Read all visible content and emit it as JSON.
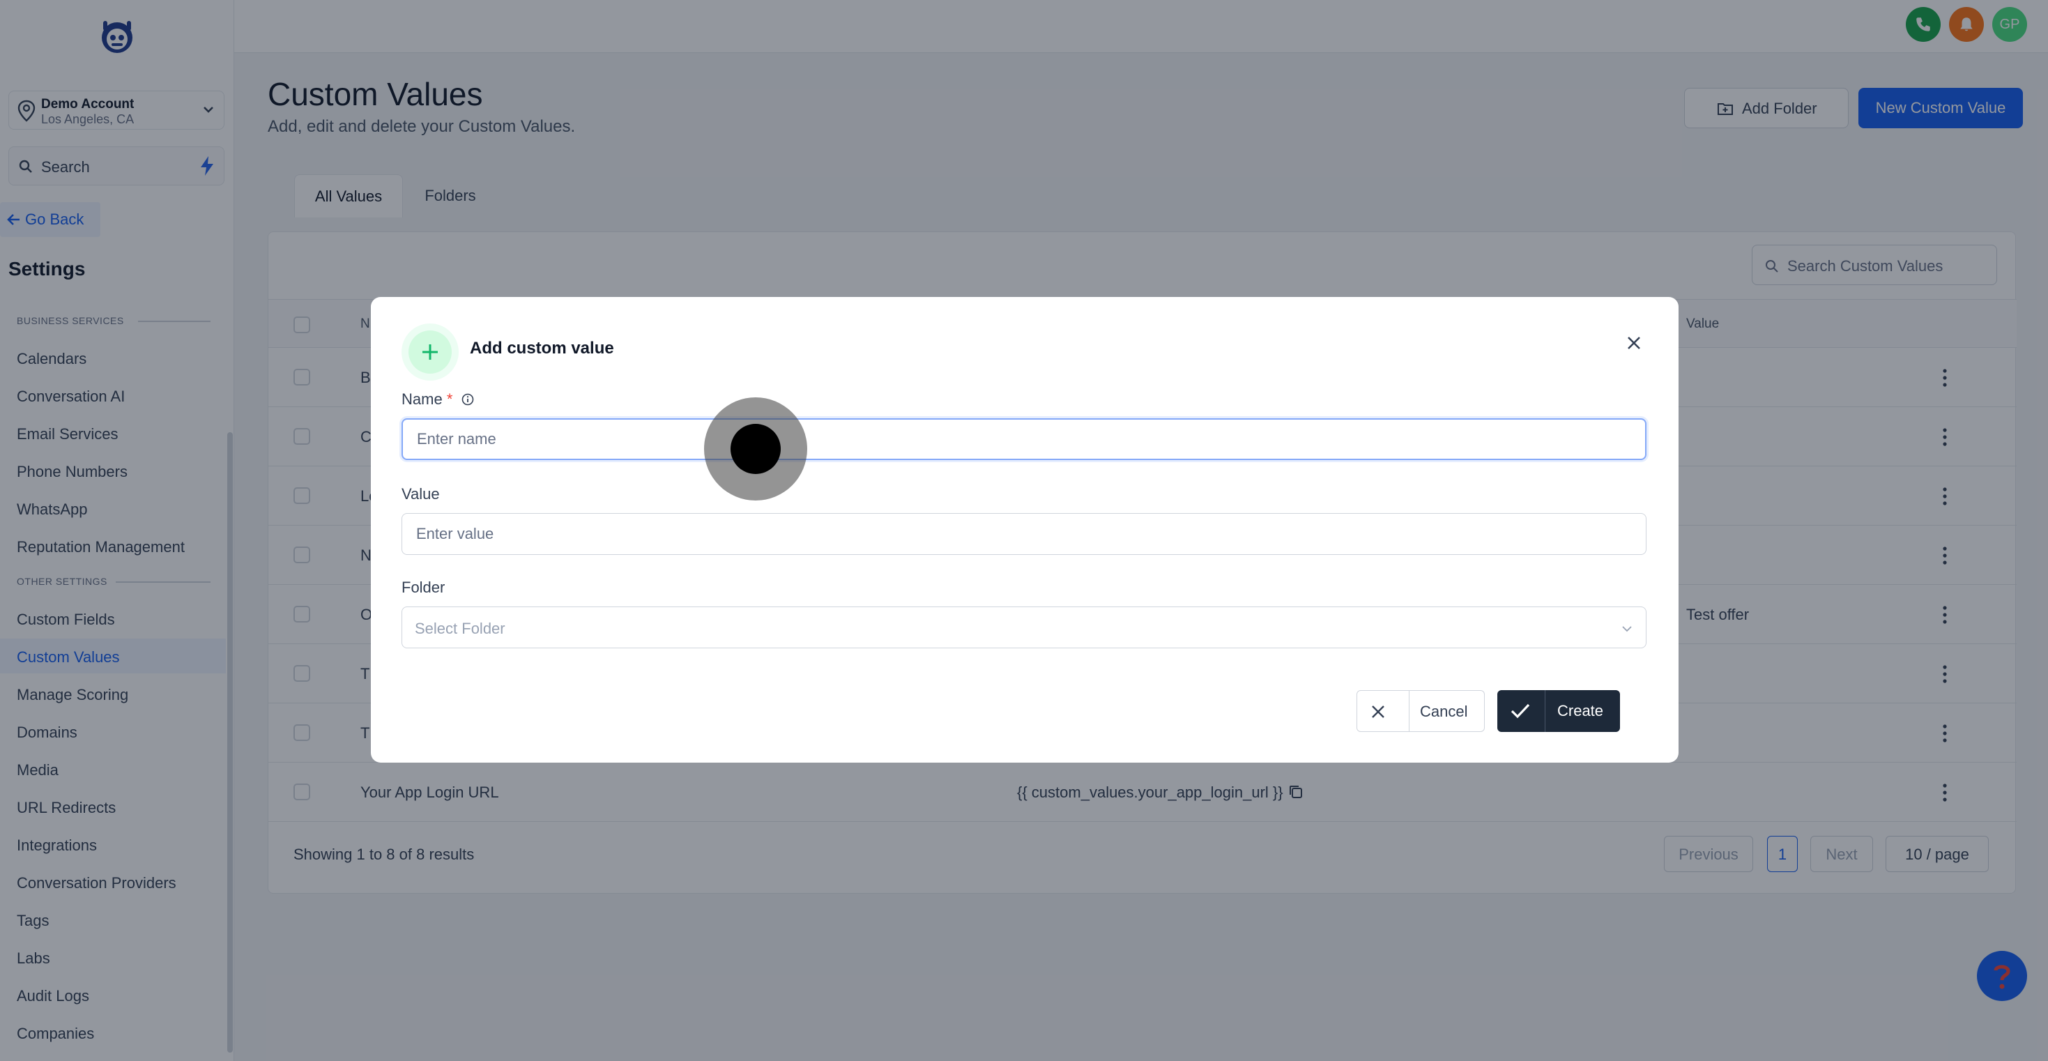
{
  "sidebar": {
    "account": {
      "name": "Demo Account",
      "location": "Los Angeles, CA"
    },
    "search_label": "Search",
    "go_back": "Go Back",
    "title": "Settings",
    "sections": [
      {
        "heading": "BUSINESS SERVICES",
        "items": [
          "Calendars",
          "Conversation AI",
          "Email Services",
          "Phone Numbers",
          "WhatsApp",
          "Reputation Management"
        ]
      },
      {
        "heading": "OTHER SETTINGS",
        "items": [
          "Custom Fields",
          "Custom Values",
          "Manage Scoring",
          "Domains",
          "Media",
          "URL Redirects",
          "Integrations",
          "Conversation Providers",
          "Tags",
          "Labs",
          "Audit Logs",
          "Companies"
        ]
      }
    ],
    "active_item": "Custom Values"
  },
  "topbar": {
    "avatar_initials": "GP",
    "colors": {
      "phone": "#16a34a",
      "bell": "#f97316",
      "avatar": "#4ade80"
    }
  },
  "header": {
    "title": "Custom Values",
    "subtitle": "Add, edit and delete your Custom Values.",
    "add_folder": "Add Folder",
    "new_value": "New Custom Value"
  },
  "tabs": [
    "All Values",
    "Folders"
  ],
  "table": {
    "search_placeholder": "Search Custom Values",
    "columns": {
      "name": "N",
      "value": "Value"
    },
    "rows": [
      {
        "name": "B",
        "key": "",
        "value": ""
      },
      {
        "name": "C",
        "key": "",
        "value": ""
      },
      {
        "name": "Lo",
        "key": "",
        "value": ""
      },
      {
        "name": "N",
        "key": "",
        "value": ""
      },
      {
        "name": "O",
        "key": "",
        "value": "Test offer"
      },
      {
        "name": "T",
        "key": "",
        "value": ""
      },
      {
        "name": "T",
        "key": "",
        "value": ""
      },
      {
        "name": "Your App Login URL",
        "key": "{{ custom_values.your_app_login_url }}",
        "value": ""
      }
    ],
    "footer": "Showing 1 to 8 of 8 results",
    "pagination": {
      "previous": "Previous",
      "page": "1",
      "next": "Next",
      "page_size": "10 / page"
    }
  },
  "modal": {
    "title": "Add custom value",
    "name_label": "Name",
    "required_mark": "*",
    "name_placeholder": "Enter name",
    "value_label": "Value",
    "value_placeholder": "Enter value",
    "folder_label": "Folder",
    "folder_placeholder": "Select Folder",
    "cancel": "Cancel",
    "create": "Create"
  },
  "accent_color": "#155eef"
}
